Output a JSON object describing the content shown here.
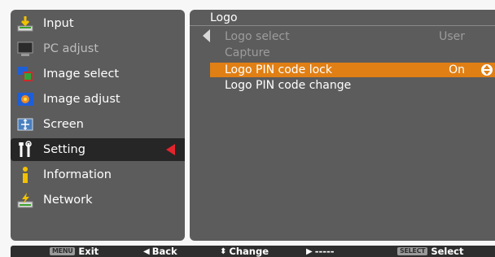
{
  "left_menu": {
    "items": [
      {
        "label": "Input",
        "icon": "input-arrow-icon",
        "state": "enabled"
      },
      {
        "label": "PC adjust",
        "icon": "monitor-icon",
        "state": "disabled"
      },
      {
        "label": "Image select",
        "icon": "image-select-icon",
        "state": "enabled"
      },
      {
        "label": "Image adjust",
        "icon": "image-adjust-icon",
        "state": "enabled"
      },
      {
        "label": "Screen",
        "icon": "screen-icon",
        "state": "enabled"
      },
      {
        "label": "Setting",
        "icon": "tools-icon",
        "state": "selected"
      },
      {
        "label": "Information",
        "icon": "information-icon",
        "state": "enabled"
      },
      {
        "label": "Network",
        "icon": "network-icon",
        "state": "enabled"
      }
    ]
  },
  "right_panel": {
    "title": "Logo",
    "items": [
      {
        "label": "Logo select",
        "value": "User",
        "state": "disabled"
      },
      {
        "label": "Capture",
        "value": "",
        "state": "disabled"
      },
      {
        "label": "Logo PIN code lock",
        "value": "On",
        "state": "highlight"
      },
      {
        "label": "Logo PIN code change",
        "value": "",
        "state": "enabled"
      }
    ]
  },
  "bottom_bar": {
    "exit": {
      "key": "MENU",
      "label": "Exit"
    },
    "back": {
      "glyph": "◀",
      "label": "Back"
    },
    "change": {
      "glyph": "⬍",
      "label": "Change"
    },
    "next": {
      "glyph": "▶",
      "label": "-----"
    },
    "select": {
      "key": "SELECT",
      "label": "Select"
    }
  },
  "colors": {
    "panel": "#5c5c5c",
    "highlight": "#e07f14",
    "selected_row": "#262626",
    "selection_arrow": "#e3252d",
    "background": "#f7f7f7"
  }
}
